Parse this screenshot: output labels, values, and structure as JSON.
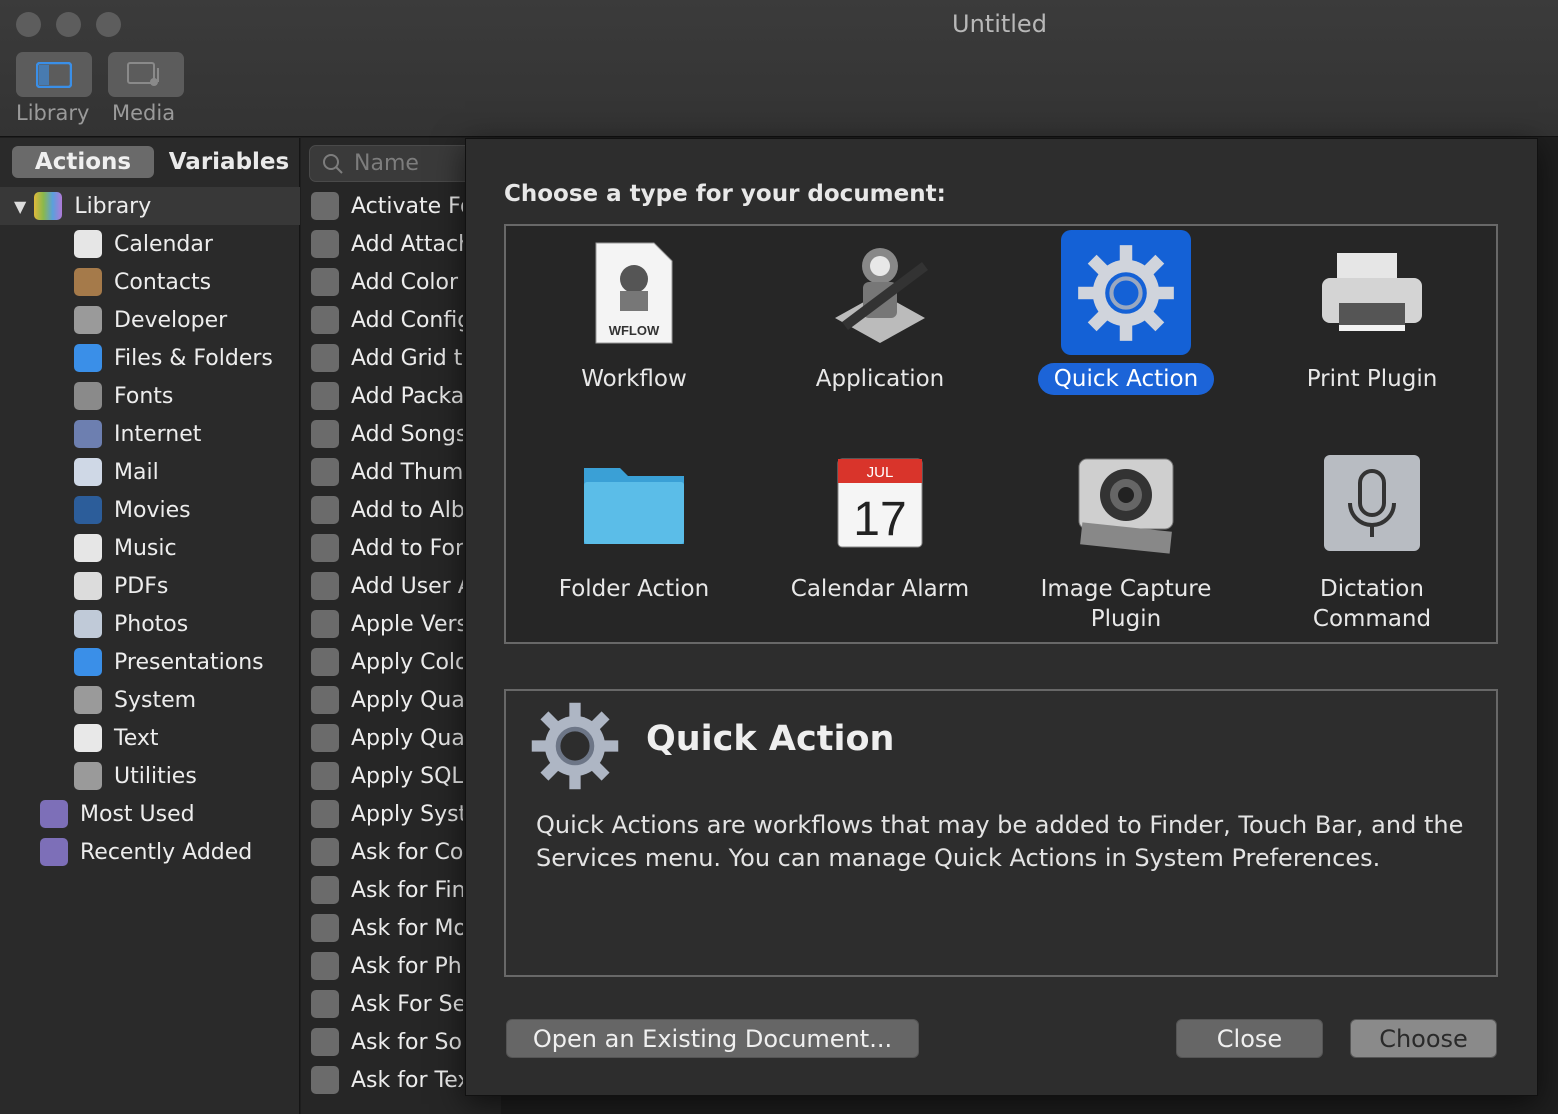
{
  "window": {
    "title": "Untitled"
  },
  "toolbar": {
    "library_label": "Library",
    "media_label": "Media"
  },
  "tabs": {
    "actions": "Actions",
    "variables": "Variables"
  },
  "search": {
    "placeholder": "Name"
  },
  "library": {
    "root": "Library",
    "items": [
      {
        "label": "Calendar",
        "icon": "calendar-icon",
        "color": "#e6e6e6"
      },
      {
        "label": "Contacts",
        "icon": "contacts-icon",
        "color": "#a57a4a"
      },
      {
        "label": "Developer",
        "icon": "tools-icon",
        "color": "#9a9a9a"
      },
      {
        "label": "Files & Folders",
        "icon": "finder-icon",
        "color": "#3a8fe8"
      },
      {
        "label": "Fonts",
        "icon": "fonts-icon",
        "color": "#8a8a8a"
      },
      {
        "label": "Internet",
        "icon": "globe-icon",
        "color": "#6d7fb0"
      },
      {
        "label": "Mail",
        "icon": "mail-icon",
        "color": "#cfd8e6"
      },
      {
        "label": "Movies",
        "icon": "quicktime-icon",
        "color": "#2c5d9a"
      },
      {
        "label": "Music",
        "icon": "music-icon",
        "color": "#e6e6e6"
      },
      {
        "label": "PDFs",
        "icon": "pdf-icon",
        "color": "#dcdcdc"
      },
      {
        "label": "Photos",
        "icon": "photos-icon",
        "color": "#c0cad8"
      },
      {
        "label": "Presentations",
        "icon": "presentation-icon",
        "color": "#3a8fe8"
      },
      {
        "label": "System",
        "icon": "gear-icon",
        "color": "#9a9a9a"
      },
      {
        "label": "Text",
        "icon": "text-icon",
        "color": "#e8e8e8"
      },
      {
        "label": "Utilities",
        "icon": "tools-icon",
        "color": "#9a9a9a"
      }
    ],
    "extra": [
      "Most Used",
      "Recently Added"
    ]
  },
  "actions": [
    "Activate Fo",
    "Add Attach",
    "Add Color",
    "Add Config",
    "Add Grid to",
    "Add Packa",
    "Add Songs",
    "Add Thumb",
    "Add to Albu",
    "Add to Fon",
    "Add User A",
    "Apple Vers",
    "Apply Colo",
    "Apply Quar",
    "Apply Quar",
    "Apply SQL",
    "Apply Syst",
    "Ask for Cor",
    "Ask for Fin",
    "Ask for Mo",
    "Ask for Pho",
    "Ask For Se",
    "Ask for Sor",
    "Ask for Tex"
  ],
  "sheet": {
    "prompt": "Choose a type for your document:",
    "types": [
      {
        "label": "Workflow",
        "icon": "workflow-icon",
        "badge": "WFLOW"
      },
      {
        "label": "Application",
        "icon": "automator-robot-icon"
      },
      {
        "label": "Quick Action",
        "icon": "gear-icon",
        "selected": true
      },
      {
        "label": "Print Plugin",
        "icon": "printer-icon"
      },
      {
        "label": "Folder Action",
        "icon": "folder-icon"
      },
      {
        "label": "Calendar Alarm",
        "icon": "calendar-icon",
        "month": "JUL",
        "day": "17"
      },
      {
        "label": "Image Capture Plugin",
        "icon": "camera-icon"
      },
      {
        "label": "Dictation Command",
        "icon": "microphone-icon"
      }
    ],
    "description": {
      "title": "Quick Action",
      "text": "Quick Actions are workflows that may be added to Finder, Touch Bar, and the Services menu. You can manage Quick Actions in System Preferences."
    },
    "buttons": {
      "open": "Open an Existing Document...",
      "close": "Close",
      "choose": "Choose"
    }
  }
}
